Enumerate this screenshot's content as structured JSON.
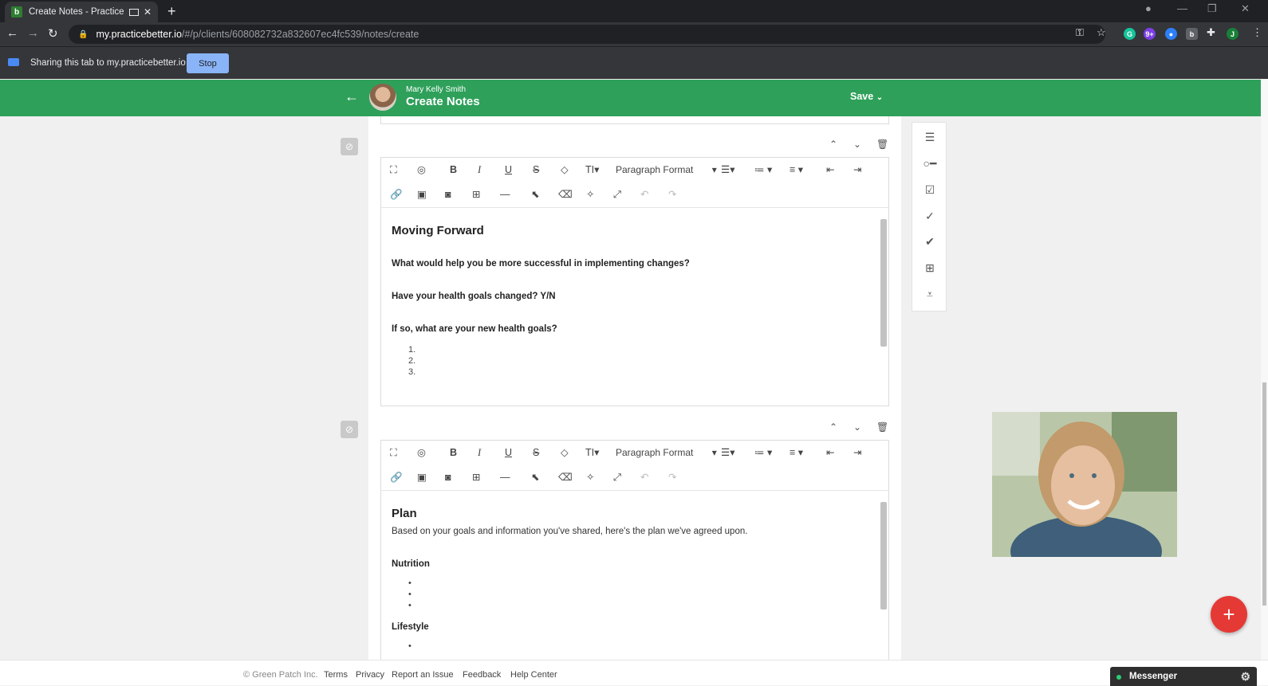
{
  "browser": {
    "tab_title": "Create Notes - Practice Bette",
    "favicon_letter": "b",
    "url_host": "my.practicebetter.io",
    "url_path": "/#/p/clients/608082732a832607ec4fc539/notes/create",
    "profile_initial": "J",
    "ext_badge": "9+"
  },
  "sharing_bar": {
    "text": "Sharing this tab to my.practicebetter.io",
    "stop_label": "Stop"
  },
  "header": {
    "client_name": "Mary Kelly Smith",
    "title": "Create Notes",
    "save_label": "Save"
  },
  "toolbar": {
    "paragraph_format": "Paragraph Format"
  },
  "section1": {
    "heading": "Moving Forward",
    "q1": "What would help you be more successful in implementing changes?",
    "q2": "Have your health goals changed? Y/N",
    "q3": "If so, what are your new health goals?",
    "list": [
      "1.",
      "2.",
      "3."
    ]
  },
  "section2": {
    "heading": "Plan",
    "intro": "Based on your goals and information you've shared, here's the plan we've agreed upon.",
    "nutrition": "Nutrition",
    "lifestyle": "Lifestyle"
  },
  "footer": {
    "copyright": "© Green Patch Inc.",
    "terms": "Terms",
    "privacy": "Privacy",
    "report": "Report an Issue",
    "feedback": "Feedback",
    "help": "Help Center"
  },
  "messenger": {
    "label": "Messenger"
  },
  "colors": {
    "brand_green": "#2ea05a",
    "fab_red": "#e53935",
    "stop_blue": "#8ab4f8"
  }
}
